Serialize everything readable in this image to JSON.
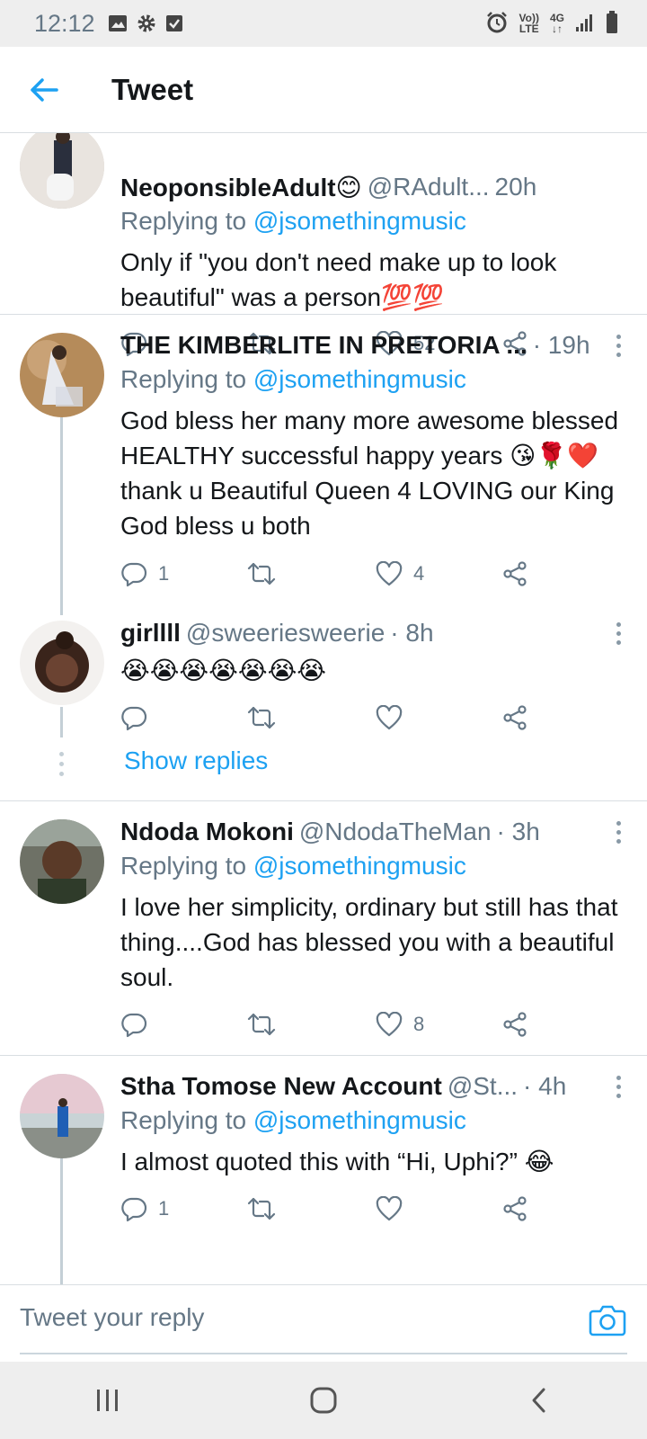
{
  "status_bar": {
    "time": "12:12",
    "left_icons": [
      "image-icon",
      "gear-icon",
      "checkbox-icon"
    ],
    "right_icons": [
      "alarm-icon",
      "volte-icon",
      "4g-icon",
      "signal-icon",
      "battery-icon"
    ],
    "volte_top": "Vo))",
    "volte_bottom": "LTE",
    "net_top": "4G",
    "net_bottom": "↓↑"
  },
  "header": {
    "title": "Tweet",
    "back_icon": "back-arrow-icon"
  },
  "tweets": [
    {
      "name": "NeoponsibleAdult😊",
      "handle": "@RAdult...",
      "time": "20h",
      "replying_prefix": "Replying to ",
      "replying_to": "@jsomethingmusic",
      "text": "Only if \"you don't need make up to look beautiful\" was a person💯💯",
      "replies": "",
      "likes": "52"
    },
    {
      "name": "THE KIMBERLITE IN PRETORIA ...",
      "handle": "",
      "time": "· 19h",
      "replying_prefix": "Replying to ",
      "replying_to": "@jsomethingmusic",
      "text": "God bless her many more awesome blessed HEALTHY successful happy years 😘🌹❤️thank u Beautiful Queen 4 LOVING our King God bless u both",
      "replies": "1",
      "likes": "4"
    },
    {
      "name": "girllll",
      "handle": "@sweeriesweerie",
      "time": "· 8h",
      "text": "😭😭😭😭😭😭😭",
      "replies": "",
      "likes": "",
      "show_replies": "Show replies"
    },
    {
      "name": "Ndoda Mokoni",
      "handle": "@NdodaTheMan",
      "time": "· 3h",
      "replying_prefix": "Replying to ",
      "replying_to": "@jsomethingmusic",
      "text": "I love her simplicity, ordinary but still has that thing....God has blessed you with a beautiful soul.",
      "replies": "",
      "likes": "8"
    },
    {
      "name": "Stha Tomose New Account",
      "handle": "@St...",
      "time": "· 4h",
      "replying_prefix": "Replying to ",
      "replying_to": "@jsomethingmusic",
      "text": "I almost quoted this with “Hi, Uphi?” 😂",
      "replies": "1",
      "likes": ""
    }
  ],
  "composer": {
    "placeholder": "Tweet your reply",
    "camera_icon": "camera-icon"
  },
  "nav_bar": {
    "buttons": [
      "recents-icon",
      "home-icon",
      "back-icon"
    ]
  },
  "colors": {
    "accent": "#1da1f2",
    "muted": "#657786",
    "text": "#14171a",
    "divider": "#d9dee2"
  }
}
